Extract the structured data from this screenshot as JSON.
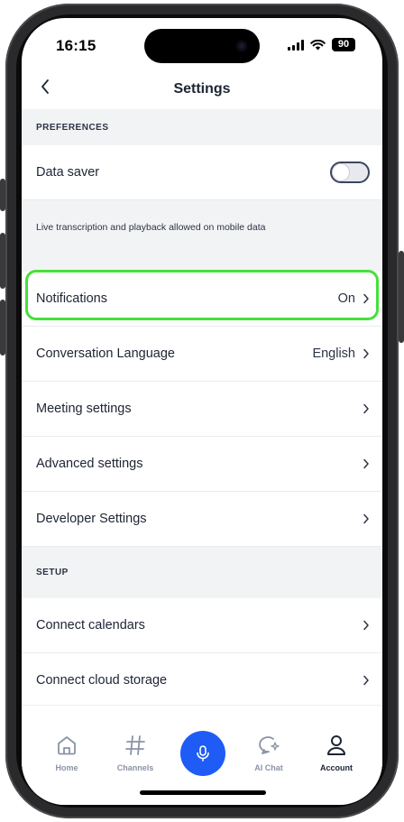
{
  "status_bar": {
    "time": "16:15",
    "battery": "90"
  },
  "header": {
    "title": "Settings"
  },
  "sections": {
    "preferences": {
      "label": "PREFERENCES",
      "data_saver": {
        "label": "Data saver",
        "enabled": false
      },
      "info": "Live transcription and playback allowed on mobile data",
      "items": [
        {
          "label": "Notifications",
          "value": "On"
        },
        {
          "label": "Conversation Language",
          "value": "English"
        },
        {
          "label": "Meeting settings",
          "value": ""
        },
        {
          "label": "Advanced settings",
          "value": ""
        },
        {
          "label": "Developer Settings",
          "value": ""
        }
      ]
    },
    "setup": {
      "label": "SETUP",
      "items": [
        {
          "label": "Connect calendars"
        },
        {
          "label": "Connect cloud storage"
        }
      ]
    }
  },
  "tab_bar": {
    "tabs": [
      {
        "label": "Home",
        "icon": "home-icon"
      },
      {
        "label": "Channels",
        "icon": "hash-icon"
      },
      {
        "label": "",
        "icon": "microphone-icon"
      },
      {
        "label": "AI Chat",
        "icon": "ai-chat-icon"
      },
      {
        "label": "Account",
        "icon": "person-icon"
      }
    ],
    "active": "Account"
  },
  "colors": {
    "accent": "#1f5cf5",
    "highlight": "#44e13a",
    "section_bg": "#f2f3f5",
    "text": "#1d2433"
  }
}
